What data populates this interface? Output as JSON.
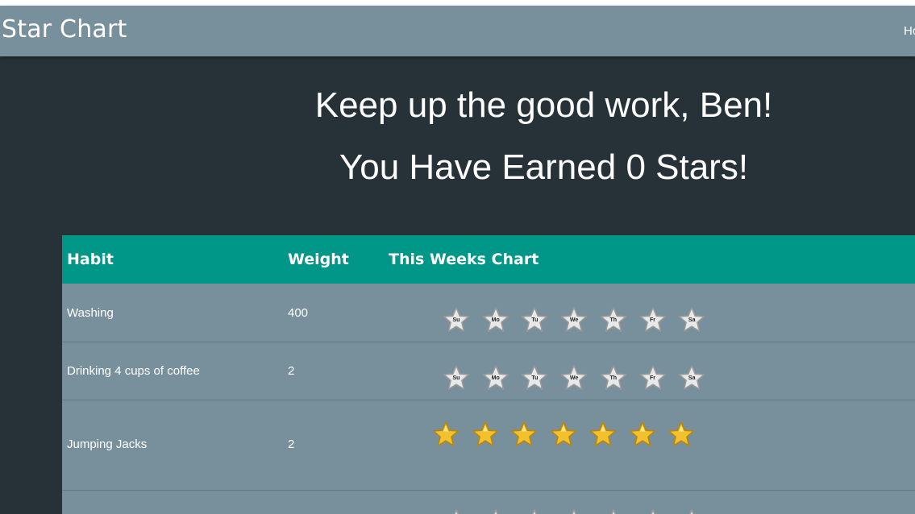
{
  "navbar": {
    "brand": "Star Chart",
    "link": "Home"
  },
  "hero": {
    "greeting": "Keep up the good work, Ben!",
    "stars_earned": "You Have Earned 0 Stars!"
  },
  "table": {
    "headers": [
      "Habit",
      "Weight",
      "This Weeks Chart"
    ],
    "days": [
      "Su",
      "Mo",
      "Tu",
      "We",
      "Th",
      "Fr",
      "Sa"
    ],
    "rows": [
      {
        "habit": "Washing",
        "weight": "400",
        "star_style": "empty"
      },
      {
        "habit": "Drinking 4 cups of coffee",
        "weight": "2",
        "star_style": "empty"
      },
      {
        "habit": "Jumping Jacks",
        "weight": "2",
        "star_style": "gold"
      },
      {
        "habit": "",
        "weight": "",
        "star_style": "empty"
      }
    ]
  },
  "colors": {
    "page_bg": "#263238",
    "navbar": "#78909c",
    "table_header": "#009688",
    "table_body": "#78909c",
    "gold_star": "#f2c12e",
    "empty_star": "#e8e8e8"
  }
}
